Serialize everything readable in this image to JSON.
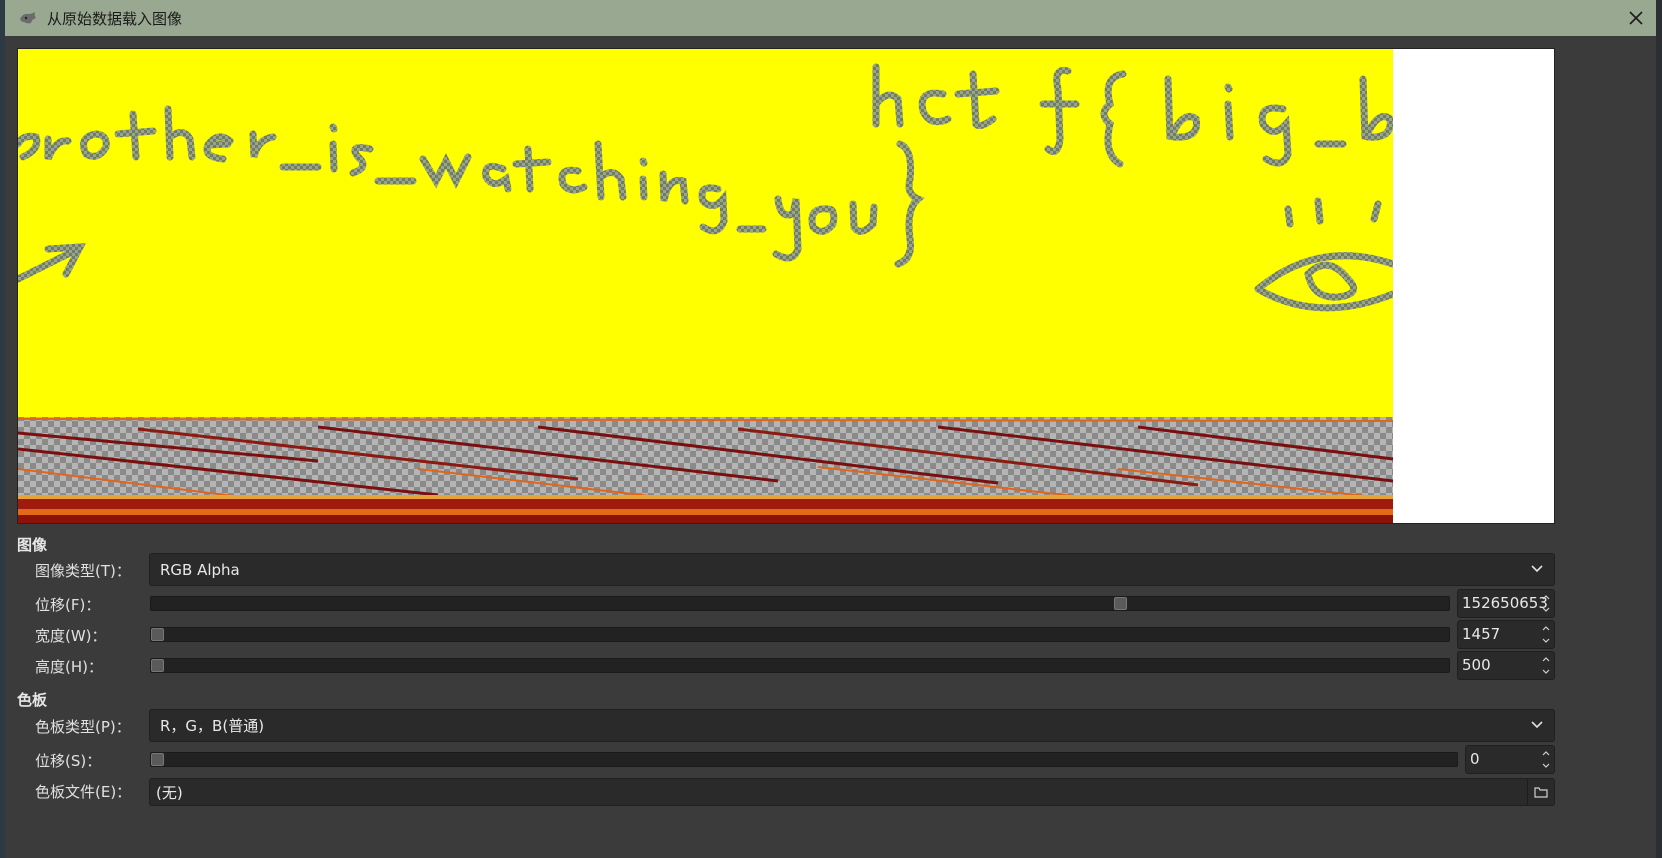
{
  "window": {
    "title": "从原始数据载入图像"
  },
  "preview": {
    "scribble_text_line1": "hct f{ big_b",
    "scribble_text_line2": "rother_is_watching_you}"
  },
  "image_section": {
    "title": "图像",
    "image_type": {
      "label": "图像类型(T)：",
      "value": "RGB Alpha"
    },
    "offset": {
      "label": "位移(F)：",
      "value": "152650653",
      "slider_fraction": 0.745
    },
    "width": {
      "label": "宽度(W)：",
      "value": "1457",
      "slider_fraction": 0.0
    },
    "height": {
      "label": "高度(H)：",
      "value": "500",
      "slider_fraction": 0.0
    }
  },
  "palette_section": {
    "title": "色板",
    "palette_type": {
      "label": "色板类型(P)：",
      "value": "R，G，B(普通)"
    },
    "offset": {
      "label": "位移(S)：",
      "value": "0",
      "slider_fraction": 0.0
    },
    "palette_file": {
      "label": "色板文件(E)：",
      "value": "(无)"
    }
  },
  "colors": {
    "titlebar": "#98a891",
    "dialog_bg": "#3b3b3b",
    "preview_yellow": "#ffff00",
    "scribble": "#7d8a6e",
    "stripe_dark": "#7a0f0f",
    "stripe_orange": "#e0661a"
  }
}
